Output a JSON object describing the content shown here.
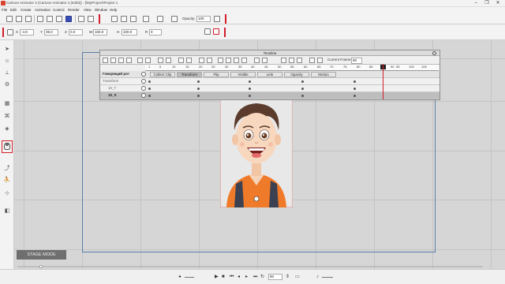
{
  "window": {
    "title": "Cartoon Animator 4 (Cartoon Animator 4 (64bit)) - [\\MyProject\\Project 1",
    "minimize": "–",
    "maximize": "❐",
    "close": "✕"
  },
  "menu": [
    "File",
    "Edit",
    "Create",
    "Animation",
    "Control",
    "Render",
    "View",
    "Window",
    "Help"
  ],
  "toolbar": {
    "opacity_label": "Opacity:",
    "opacity_value": "100"
  },
  "transform": {
    "x_label": "X",
    "x_value": "-4.9",
    "y_label": "Y",
    "y_value": "39.0",
    "z_label": "Z",
    "z_value": "0.0",
    "w_label": "W",
    "w_value": "100.0",
    "h_label": "H",
    "h_value": "100.0",
    "r_label": "R",
    "r_value": "0"
  },
  "timeline": {
    "title": "Timeline",
    "current_frame_label": "Current Frame:",
    "current_frame_value": "90",
    "ruler_ticks": [
      "1",
      "5",
      "10",
      "15",
      "20",
      "25",
      "30",
      "35",
      "40",
      "45",
      "50",
      "55",
      "60",
      "65",
      "70",
      "75",
      "80",
      "85",
      "90",
      "95",
      "100",
      "105"
    ],
    "actor_track": "Говорящий рот",
    "tracks": [
      "Transform",
      "10_T",
      "10_S"
    ],
    "chips": [
      "Collect Clip",
      "Transform",
      "Flip",
      "Visible",
      "Link",
      "Opacity",
      "Motion"
    ]
  },
  "stage": {
    "mode_button": "STAGE MODE"
  },
  "statusbar": {
    "frame_value": "90"
  },
  "colors": {
    "accent_red": "#d21f2a",
    "stage_border": "#5b7fa8",
    "shirt": "#ef7a2a"
  }
}
